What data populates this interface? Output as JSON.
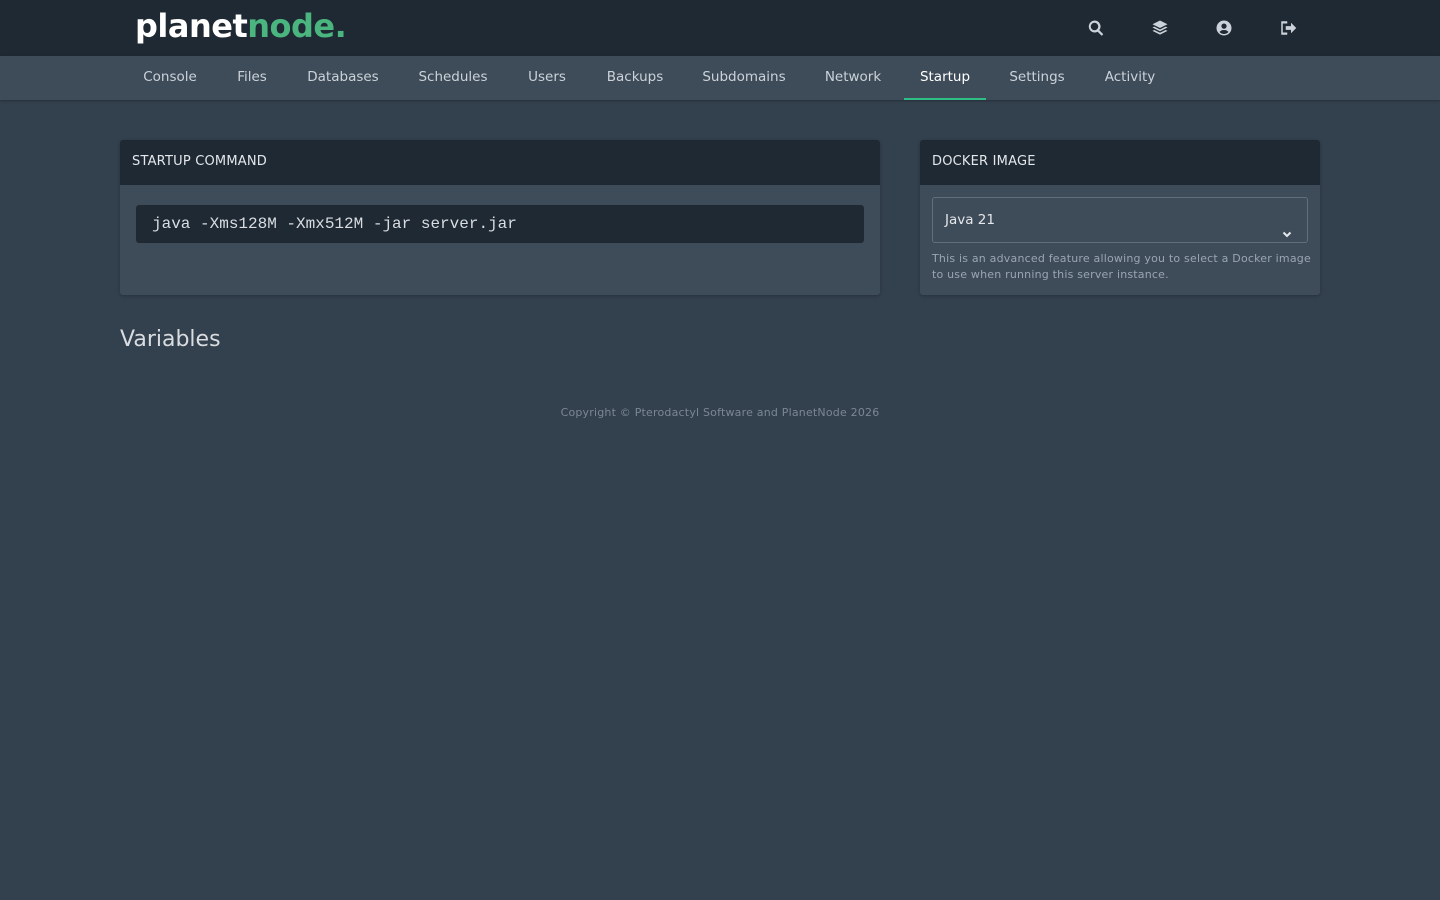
{
  "brand": {
    "part1": "planet",
    "part2": "node."
  },
  "top_icons": [
    "search-icon",
    "layers-icon",
    "user-circle-icon",
    "sign-out-icon"
  ],
  "nav": {
    "tabs": [
      {
        "label": "Console"
      },
      {
        "label": "Files"
      },
      {
        "label": "Databases"
      },
      {
        "label": "Schedules"
      },
      {
        "label": "Users"
      },
      {
        "label": "Backups"
      },
      {
        "label": "Subdomains"
      },
      {
        "label": "Network"
      },
      {
        "label": "Startup",
        "active": true
      },
      {
        "label": "Settings"
      },
      {
        "label": "Activity"
      }
    ]
  },
  "startup": {
    "title": "STARTUP COMMAND",
    "command": "java -Xms128M -Xmx512M -jar server.jar"
  },
  "docker": {
    "title": "DOCKER IMAGE",
    "selected": "Java 21",
    "help": "This is an advanced feature allowing you to select a Docker image to use when running this server instance."
  },
  "variables": {
    "title": "Variables"
  },
  "footer": {
    "text": "Copyright © Pterodactyl Software and PlanetNode 2026"
  },
  "colors": {
    "accent": "#2fbf84",
    "brand_green": "#4ab57e",
    "background": "#33404d",
    "topbar": "#1f2933"
  }
}
